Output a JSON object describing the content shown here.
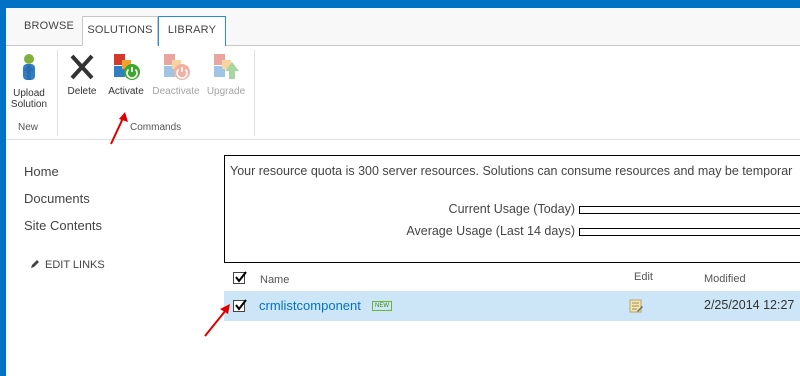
{
  "tabs": {
    "browse": "BROWSE",
    "solutions": "SOLUTIONS",
    "library": "LIBRARY"
  },
  "ribbon": {
    "upload_label": "Upload\nSolution",
    "new_group": "New",
    "delete_label": "Delete",
    "activate_label": "Activate",
    "deactivate_label": "Deactivate",
    "upgrade_label": "Upgrade",
    "commands_group": "Commands"
  },
  "nav": {
    "home": "Home",
    "documents": "Documents",
    "site_contents": "Site Contents",
    "edit_links": "EDIT LINKS"
  },
  "quota": {
    "message": "Your resource quota is 300 server resources. Solutions can consume resources and may be temporar",
    "current_label": "Current Usage (Today)",
    "average_label": "Average Usage (Last 14 days)"
  },
  "list": {
    "col_name": "Name",
    "col_edit": "Edit",
    "col_modified": "Modified",
    "rows": [
      {
        "name": "crmlistcomponent",
        "badge": "NEW",
        "modified": "2/25/2014 12:27"
      }
    ]
  },
  "colors": {
    "accent": "#0072c6",
    "selected_row": "#cde6f7",
    "annotation_arrow": "#e00000"
  }
}
